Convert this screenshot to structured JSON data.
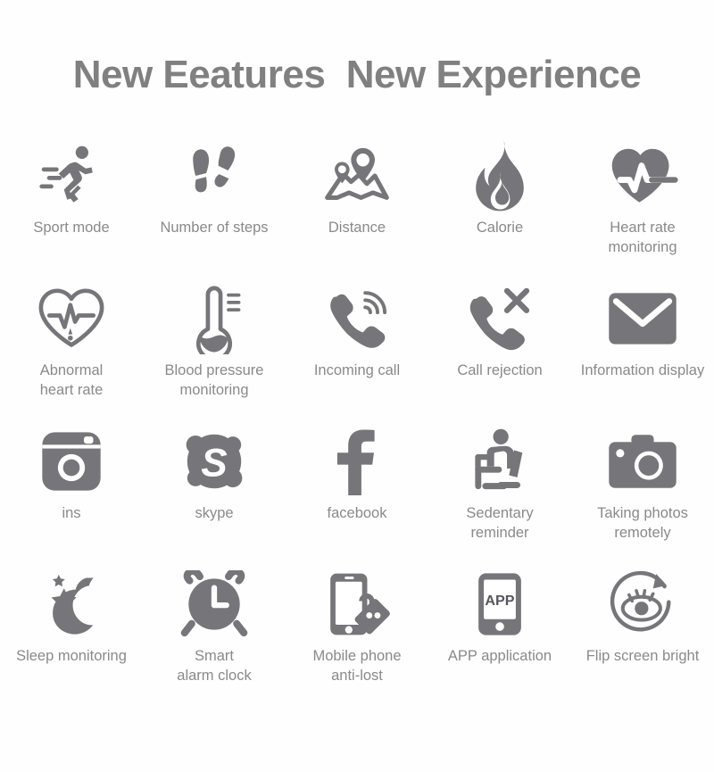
{
  "title": "New Eeatures  New Experience",
  "colors": {
    "icon": "#76767a",
    "label": "#8a8a8a",
    "title": "#808080",
    "background": "#ffffff"
  },
  "rows": [
    {
      "cells": [
        {
          "label": "Sport mode",
          "icon": "running-person-icon"
        },
        {
          "label": "Number of steps",
          "icon": "footprints-icon"
        },
        {
          "label": "Distance",
          "icon": "map-pins-icon"
        },
        {
          "label": "Calorie",
          "icon": "flame-icon"
        },
        {
          "label": "Heart rate\nmonitoring",
          "icon": "heart-pulse-filled-icon"
        }
      ]
    },
    {
      "cells": [
        {
          "label": "Abnormal\nheart rate",
          "icon": "heart-outline-ecg-icon"
        },
        {
          "label": "Blood pressure\nmonitoring",
          "icon": "thermometer-bulb-icon"
        },
        {
          "label": "Incoming call",
          "icon": "phone-ringing-icon"
        },
        {
          "label": "Call rejection",
          "icon": "phone-reject-icon"
        },
        {
          "label": "Information display",
          "icon": "envelope-icon"
        }
      ]
    },
    {
      "cells": [
        {
          "label": "ins",
          "icon": "instagram-icon"
        },
        {
          "label": "skype",
          "icon": "skype-icon"
        },
        {
          "label": "facebook",
          "icon": "facebook-icon"
        },
        {
          "label": "Sedentary\nreminder",
          "icon": "seated-person-icon"
        },
        {
          "label": "Taking photos\nremotely",
          "icon": "camera-icon"
        }
      ]
    },
    {
      "cells": [
        {
          "label": "Sleep monitoring",
          "icon": "moon-stars-icon"
        },
        {
          "label": "Smart\nalarm clock",
          "icon": "alarm-clock-icon"
        },
        {
          "label": "Mobile phone\nanti-lost",
          "icon": "phone-lock-icon"
        },
        {
          "label": "APP application",
          "icon": "phone-app-icon",
          "glyph": "APP"
        },
        {
          "label": "Flip screen bright",
          "icon": "eye-rotate-icon"
        }
      ]
    }
  ]
}
